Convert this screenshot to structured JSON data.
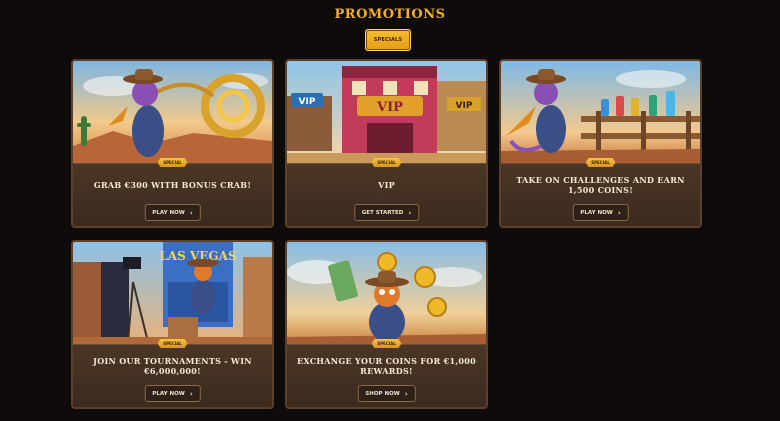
{
  "page": {
    "title": "PROMOTIONS"
  },
  "filters": {
    "active_tab": "SPECIALS"
  },
  "cards": [
    {
      "badge": "SPECIAL",
      "title": "GRAB €300 WITH BONUS CRAB!",
      "button": "PLAY NOW"
    },
    {
      "badge": "SPECIAL",
      "title": "VIP",
      "button": "GET STARTED"
    },
    {
      "badge": "SPECIAL",
      "title": "TAKE ON CHALLENGES AND EARN 1,500 COINS!",
      "button": "PLAY NOW"
    },
    {
      "badge": "SPECIAL",
      "title": "JOIN OUR TOURNAMENTS - WIN €6,000,000!",
      "button": "PLAY NOW"
    },
    {
      "badge": "SPECIAL",
      "title": "EXCHANGE YOUR COINS FOR €1,000 REWARDS!",
      "button": "SHOP NOW"
    }
  ],
  "art_text": {
    "vip_sign_left": "VIP",
    "vip_sign_center": "VIP",
    "vip_sign_right": "VIP",
    "las_vegas_sign": "LAS VEGAS"
  },
  "icons": {
    "button_arrow": "chevron-right-icon"
  }
}
